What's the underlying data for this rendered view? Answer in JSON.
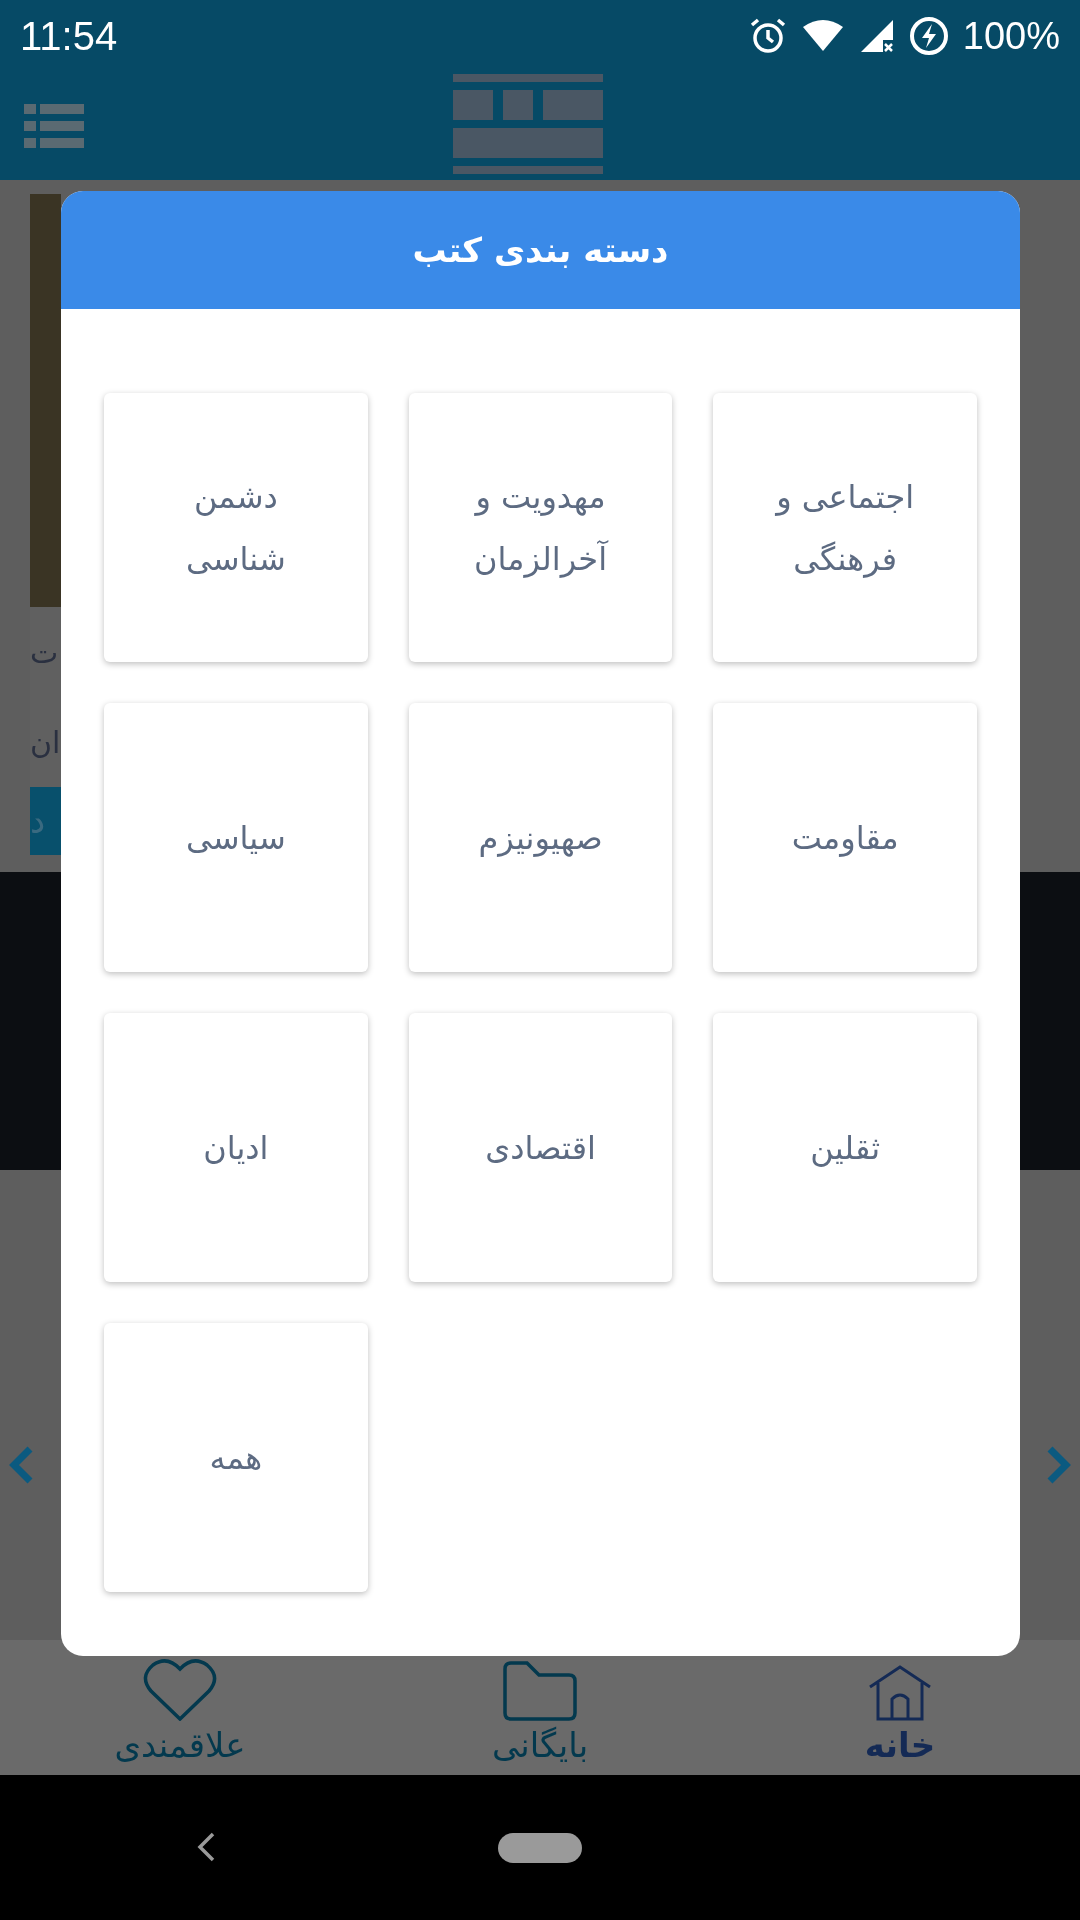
{
  "status_bar": {
    "time": "11:54",
    "battery": "100%"
  },
  "background": {
    "fragments": [
      "ت",
      "ان"
    ],
    "button_fragment": "د"
  },
  "dialog": {
    "title": "دسته بندی کتب",
    "categories": [
      {
        "label": "اجتماعی و فرهنگی"
      },
      {
        "label": "مهدویت و آخرالزمان"
      },
      {
        "label": "دشمن شناسی"
      },
      {
        "label": "مقاومت"
      },
      {
        "label": "صهیونیزم"
      },
      {
        "label": "سیاسی"
      },
      {
        "label": "ثقلین"
      },
      {
        "label": "اقتصادی"
      },
      {
        "label": "ادیان"
      },
      {
        "label": "همه"
      }
    ]
  },
  "bottom_nav": [
    {
      "label": "خانه",
      "kind": "home",
      "selected": true
    },
    {
      "label": "بایگانی",
      "kind": "folder",
      "selected": false
    },
    {
      "label": "علاقمندی",
      "kind": "heart",
      "selected": false
    }
  ]
}
